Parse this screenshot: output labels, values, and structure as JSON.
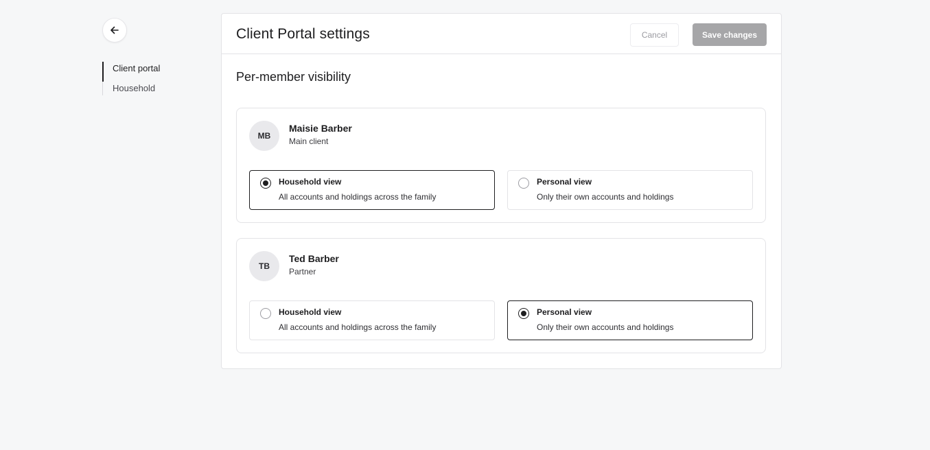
{
  "nav": {
    "back_icon": "arrow-left-icon",
    "items": [
      {
        "label": "Client portal",
        "active": true
      },
      {
        "label": "Household",
        "active": false
      }
    ]
  },
  "header": {
    "title": "Client Portal settings",
    "cancel_label": "Cancel",
    "save_label": "Save changes"
  },
  "section": {
    "title": "Per-member visibility"
  },
  "members": [
    {
      "initials": "MB",
      "name": "Maisie Barber",
      "role": "Main client",
      "options": [
        {
          "title": "Household view",
          "description": "All accounts and holdings across the family",
          "selected": true
        },
        {
          "title": "Personal view",
          "description": "Only their own accounts and holdings",
          "selected": false
        }
      ]
    },
    {
      "initials": "TB",
      "name": "Ted Barber",
      "role": "Partner",
      "options": [
        {
          "title": "Household view",
          "description": "All accounts and holdings across the family",
          "selected": false
        },
        {
          "title": "Personal view",
          "description": "Only their own accounts and holdings",
          "selected": true
        }
      ]
    }
  ],
  "colors": {
    "background": "#f6f7f8",
    "text": "#1d1d1f",
    "save_button_disabled": "#a6a6a8",
    "border": "#e3e3e6"
  }
}
